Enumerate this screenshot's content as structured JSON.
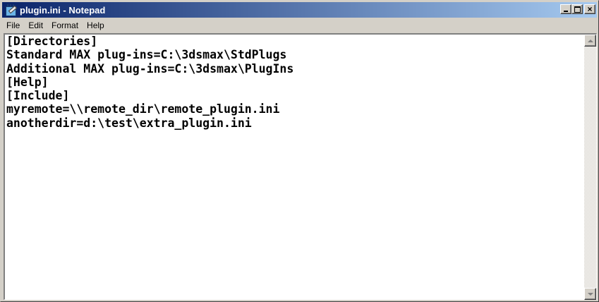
{
  "window": {
    "title": "plugin.ini - Notepad",
    "minimize_glyph": "",
    "close_glyph": "×"
  },
  "menu": {
    "items": [
      "File",
      "Edit",
      "Format",
      "Help"
    ]
  },
  "document": {
    "lines": [
      "[Directories]",
      "Standard MAX plug-ins=C:\\3dsmax\\StdPlugs",
      "Additional MAX plug-ins=C:\\3dsmax\\PlugIns",
      "[Help]",
      "[Include]",
      "myremote=\\\\remote_dir\\remote_plugin.ini",
      "anotherdir=d:\\test\\extra_plugin.ini"
    ]
  },
  "colors": {
    "titlebar_start": "#0a246a",
    "titlebar_end": "#a6caf0",
    "chrome": "#d4d0c8"
  },
  "icons": {
    "app": "notepad-icon",
    "scroll_up": "arrow-up-icon",
    "scroll_down": "arrow-down-icon"
  }
}
